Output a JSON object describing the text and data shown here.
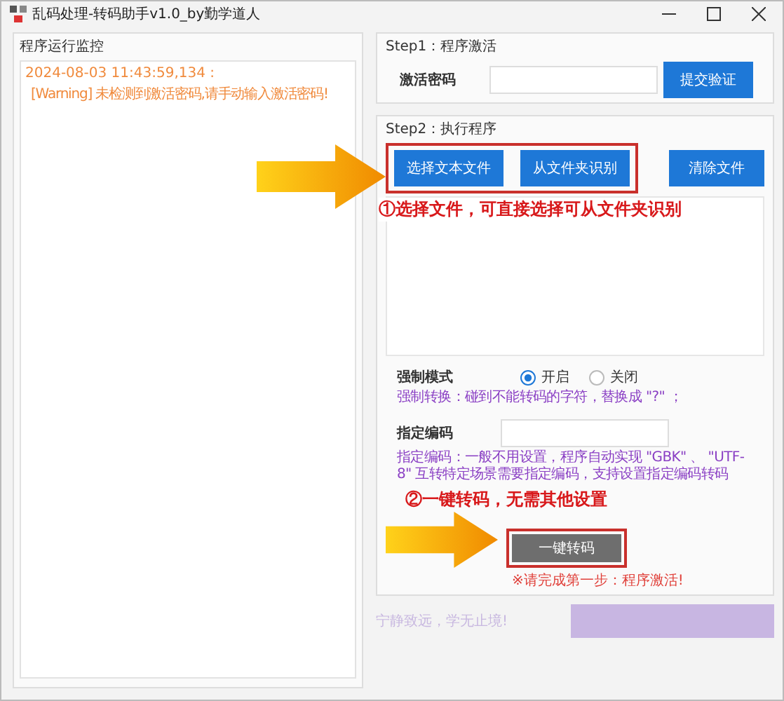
{
  "window": {
    "title": "乱码处理-转码助手v1.0_by勤学道人"
  },
  "log_panel": {
    "title": "程序运行监控",
    "entries": [
      {
        "timestamp": "2024-08-03 11:43:59,134 :",
        "message": "[Warning] 未检测到激活密码,请手动输入激活密码!"
      }
    ]
  },
  "step1": {
    "title": "Step1：程序激活",
    "label": "激活密码",
    "button": "提交验证"
  },
  "step2": {
    "title": "Step2：执行程序",
    "buttons": [
      {
        "label": "选择文本文件",
        "highlighted": true
      },
      {
        "label": "从文件夹识别",
        "highlighted": true
      },
      {
        "label": "清除文件",
        "highlighted": false
      }
    ],
    "annotation_1": "①选择文件，可直接选择可从文件夹识别",
    "force_mode": {
      "label": "强制模式",
      "options": [
        {
          "label": "开启",
          "selected": true
        },
        {
          "label": "关闭",
          "selected": false
        }
      ],
      "hint": "强制转换：碰到不能转码的字符，替换成 \"?\" ；"
    },
    "encoding": {
      "label": "指定编码",
      "hint": "指定编码：一般不用设置，程序自动实现 \"GBK\" 、 \"UTF-8\" 互转特定场景需要指定编码，支持设置指定编码转码"
    },
    "annotation_2": "②一键转码，无需其他设置",
    "convert_button": "一键转码",
    "warning": "※请完成第一步：程序激活!"
  },
  "footer": {
    "motto": "宁静致远，学无止境!"
  }
}
